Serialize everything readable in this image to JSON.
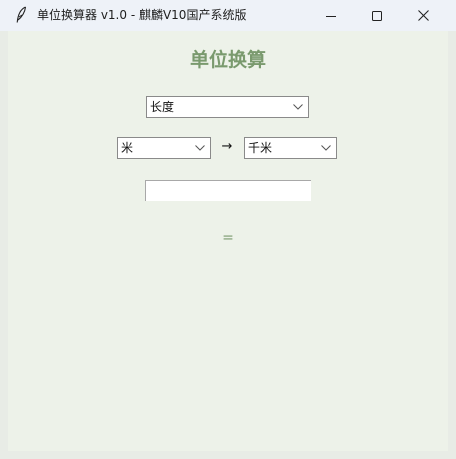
{
  "window": {
    "title": "单位换算器 v1.0 - 麒麟V10国产系统版",
    "icon": "feather-icon",
    "controls": [
      "minimize-icon",
      "maximize-icon",
      "close-icon"
    ]
  },
  "main": {
    "heading": "单位换算",
    "category_select": {
      "selected": "长度"
    },
    "from_unit_select": {
      "selected": "米"
    },
    "arrow": "→",
    "to_unit_select": {
      "selected": "千米"
    },
    "value_input": {
      "value": "",
      "placeholder": ""
    },
    "result_text": "="
  },
  "colors": {
    "accent": "#7a9a6e",
    "background": "#edf2e9",
    "titlebar": "#eef2f8"
  }
}
